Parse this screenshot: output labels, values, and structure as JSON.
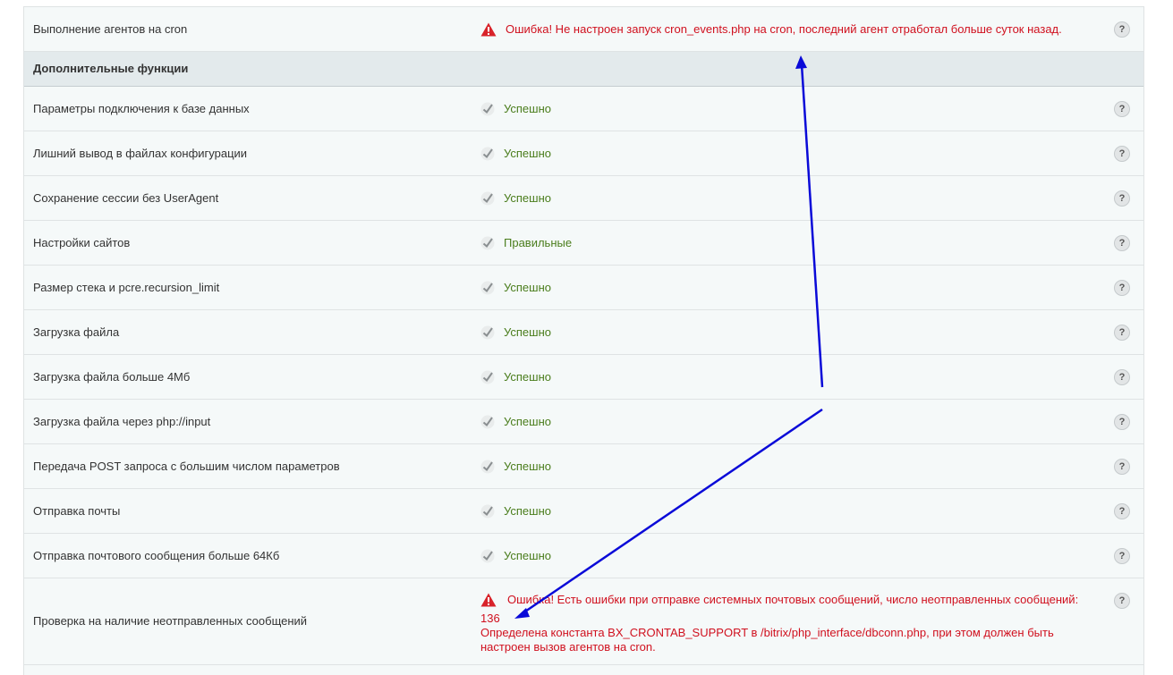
{
  "rows_top": {
    "cron": {
      "name": "Выполнение агентов на cron",
      "status": "Ошибка! Не настроен запуск cron_events.php на cron, последний агент отработал больше суток назад.",
      "help": "?"
    }
  },
  "section": {
    "title": "Дополнительные функции"
  },
  "rows": [
    {
      "name": "Параметры подключения к базе данных",
      "status": "Успешно",
      "help": "?"
    },
    {
      "name": "Лишний вывод в файлах конфигурации",
      "status": "Успешно",
      "help": "?"
    },
    {
      "name": "Сохранение сессии без UserAgent",
      "status": "Успешно",
      "help": "?"
    },
    {
      "name": "Настройки сайтов",
      "status": "Правильные",
      "help": "?"
    },
    {
      "name": "Размер стека и pcre.recursion_limit",
      "status": "Успешно",
      "help": "?"
    },
    {
      "name": "Загрузка файла",
      "status": "Успешно",
      "help": "?"
    },
    {
      "name": "Загрузка файла больше 4Мб",
      "status": "Успешно",
      "help": "?"
    },
    {
      "name": "Загрузка файла через php://input",
      "status": "Успешно",
      "help": "?"
    },
    {
      "name": "Передача POST запроса с большим числом параметров",
      "status": "Успешно",
      "help": "?"
    },
    {
      "name": "Отправка почты",
      "status": "Успешно",
      "help": "?"
    },
    {
      "name": "Отправка почтового сообщения больше 64Кб",
      "status": "Успешно",
      "help": "?"
    }
  ],
  "mail_check": {
    "name": "Проверка на наличие неотправленных сообщений",
    "error_line1": "Ошибка! Есть ошибки при отправке системных почтовых сообщений, число неотправленных сообщений:",
    "count": "136",
    "error_line2": "Определена константа BX_CRONTAB_SUPPORT в /bitrix/php_interface/dbconn.php, при этом должен быть настроен вызов агентов на cron.",
    "help": "?"
  },
  "colors": {
    "ok": "#4a7d1c",
    "error": "#d0101e",
    "arrow": "#0a0ad8"
  },
  "icons": {
    "ok": "check-icon",
    "error": "warning-triangle-icon",
    "help": "question-icon"
  }
}
